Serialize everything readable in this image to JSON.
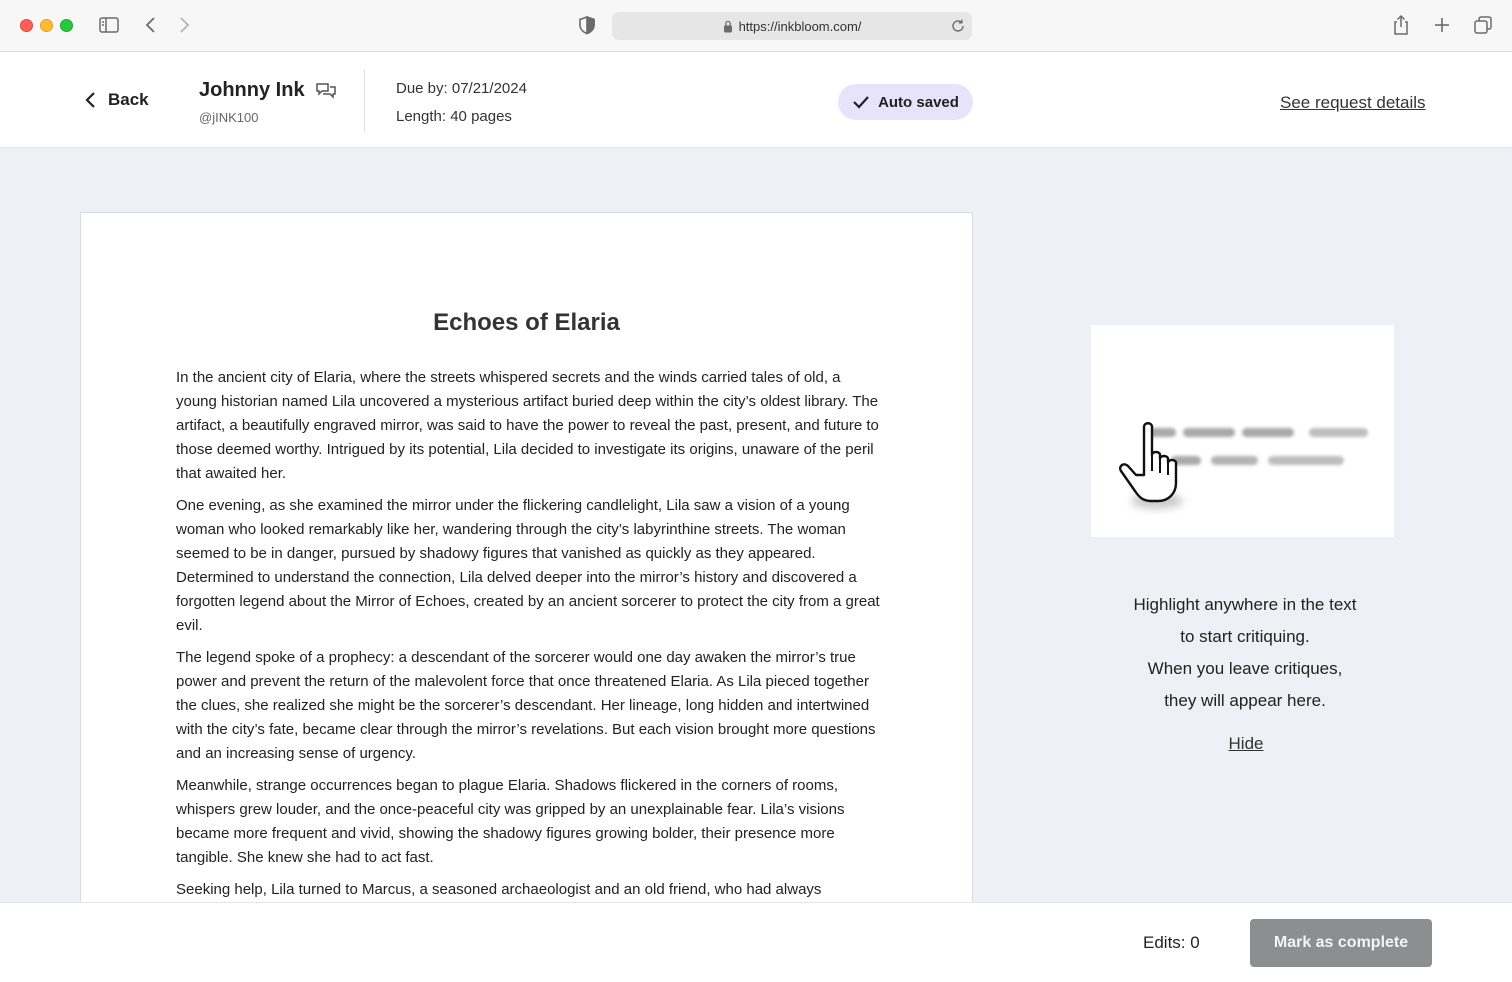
{
  "browser": {
    "url": "https://inkbloom.com/"
  },
  "header": {
    "back_label": "Back",
    "user_name": "Johnny Ink",
    "user_handle": "@jINK100",
    "due": "Due by: 07/21/2024",
    "length": "Length: 40 pages",
    "autosave_label": "Auto saved",
    "request_link": "See request details"
  },
  "document": {
    "title": "Echoes of Elaria",
    "paragraphs": [
      "In the ancient city of Elaria, where the streets whispered secrets and the winds carried tales of old, a young historian named Lila uncovered a mysterious artifact buried deep within the city’s oldest library. The artifact, a beautifully engraved mirror, was said to have the power to reveal the past, present, and future to those deemed worthy. Intrigued by its potential, Lila decided to investigate its origins, unaware of the peril that awaited her.",
      "One evening, as she examined the mirror under the flickering candlelight, Lila saw a vision of a young woman who looked remarkably like her, wandering through the city’s labyrinthine streets. The woman seemed to be in danger, pursued by shadowy figures that vanished as quickly as they appeared. Determined to understand the connection, Lila delved deeper into the mirror’s history and discovered a forgotten legend about the Mirror of Echoes, created by an ancient sorcerer to protect the city from a great evil.",
      "The legend spoke of a prophecy: a descendant of the sorcerer would one day awaken the mirror’s true power and prevent the return of the malevolent force that once threatened Elaria. As Lila pieced together the clues, she realized she might be the sorcerer’s descendant. Her lineage, long hidden and intertwined with the city’s fate, became clear through the mirror’s revelations. But each vision brought more questions and an increasing sense of urgency.",
      "Meanwhile, strange occurrences began to plague Elaria. Shadows flickered in the corners of rooms, whispers grew louder, and the once-peaceful city was gripped by an unexplainable fear. Lila’s visions became more frequent and vivid, showing the shadowy figures growing bolder, their presence more tangible. She knew she had to act fast.",
      "Seeking help, Lila turned to Marcus, a seasoned archaeologist and an old friend, who had always"
    ]
  },
  "panel": {
    "hint_lines": [
      "Highlight anywhere in the text",
      "to start critiquing.",
      "When you leave critiques,",
      "they will appear here."
    ],
    "hide_label": "Hide"
  },
  "footer": {
    "edits_label": "Edits: 0",
    "complete_label": "Mark as complete"
  },
  "colors": {
    "autosave_bg": "#e7e3fb",
    "complete_bg": "#8c8e92",
    "page_bg": "#edf0f5"
  }
}
